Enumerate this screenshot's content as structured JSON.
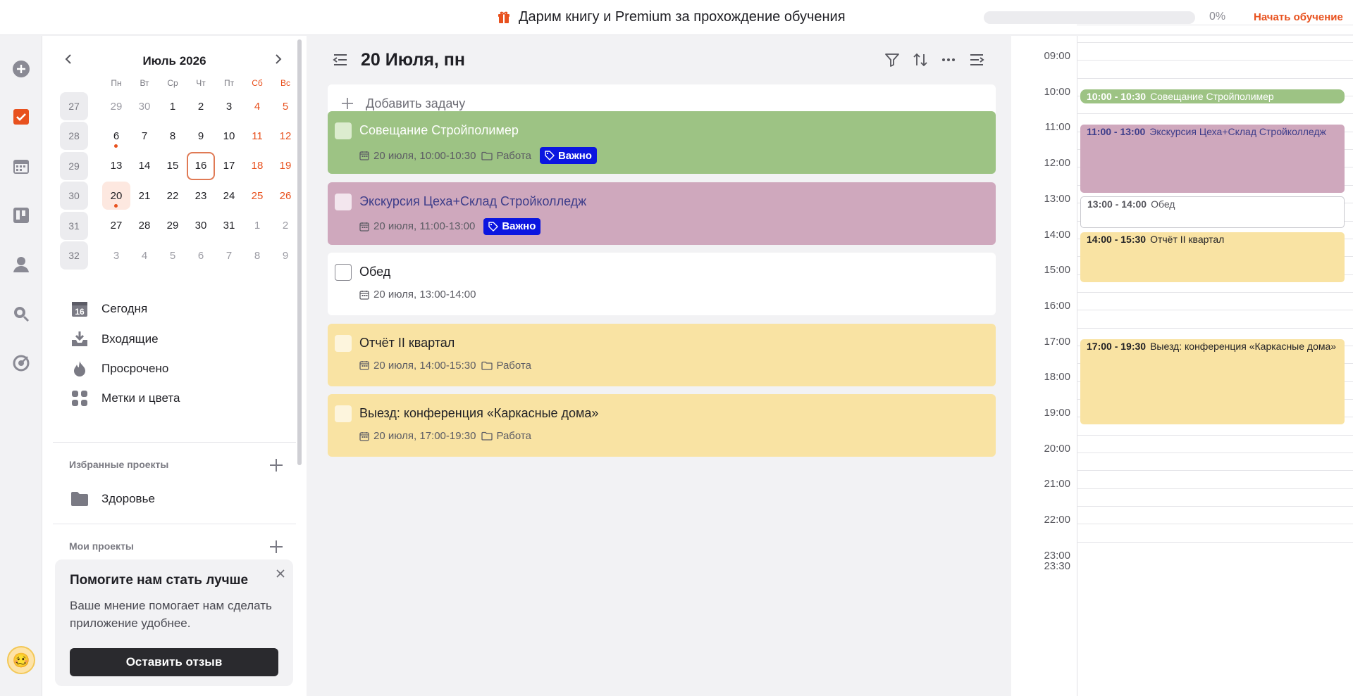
{
  "banner": {
    "promo_icon": "gift-icon",
    "promo_text": "Дарим книгу и Premium за прохождение обучения",
    "progress_percent": 0,
    "progress_label": "0%",
    "start_label": "Начать обучение",
    "accent": "#e8511e"
  },
  "rail": {
    "icons": [
      "add-circle-icon",
      "checkbox-icon",
      "calendar-icon",
      "board-icon",
      "user-icon",
      "search-icon",
      "target-icon"
    ],
    "avatar_emoji": "🥴"
  },
  "calendar": {
    "month_label": "Июль 2026",
    "weekdays": [
      "Пн",
      "Вт",
      "Ср",
      "Чт",
      "Пт",
      "Сб",
      "Вс"
    ],
    "weeks": [
      {
        "num": "27",
        "days": [
          "29",
          "30",
          "1",
          "2",
          "3",
          "4",
          "5"
        ]
      },
      {
        "num": "28",
        "days": [
          "6",
          "7",
          "8",
          "9",
          "10",
          "11",
          "12"
        ]
      },
      {
        "num": "29",
        "days": [
          "13",
          "14",
          "15",
          "16",
          "17",
          "18",
          "19"
        ]
      },
      {
        "num": "30",
        "days": [
          "20",
          "21",
          "22",
          "23",
          "24",
          "25",
          "26"
        ]
      },
      {
        "num": "31",
        "days": [
          "27",
          "28",
          "29",
          "30",
          "31",
          "1",
          "2"
        ]
      },
      {
        "num": "32",
        "days": [
          "3",
          "4",
          "5",
          "6",
          "7",
          "8",
          "9"
        ]
      }
    ],
    "today": "16",
    "selected": "20"
  },
  "nav": {
    "items": [
      {
        "label": "Сегодня",
        "icon": "calendar-16-icon"
      },
      {
        "label": "Входящие",
        "icon": "inbox-icon"
      },
      {
        "label": "Просрочено",
        "icon": "flame-icon"
      },
      {
        "label": "Метки и цвета",
        "icon": "grid-icon"
      }
    ]
  },
  "favorites": {
    "title": "Избранные проекты",
    "projects": [
      {
        "label": "Здоровье",
        "icon": "folder-icon"
      }
    ]
  },
  "my_projects": {
    "title": "Мои проекты"
  },
  "feedback": {
    "title": "Помогите нам стать лучше",
    "text": "Ваше мнение помогает нам сделать приложение удобнее.",
    "button": "Оставить отзыв"
  },
  "main": {
    "title": "20 Июля, пн",
    "add_task_placeholder": "Добавить задачу",
    "tasks": [
      {
        "title": "Совещание Стройполимер",
        "date": "20 июля, 10:00-10:30",
        "project": "Работа",
        "tag": "Важно",
        "bg": "#9dc384",
        "title_color": "#ffffff",
        "cb_color": "#dceccf"
      },
      {
        "title": "Экскурсия Цеха+Склад Стройколледж",
        "date": "20 июля, 11:00-13:00",
        "project": "",
        "tag": "Важно",
        "bg": "#cfa8bd",
        "title_color": "#3d3d8a",
        "cb_color": "#f3e6ee"
      },
      {
        "title": "Обед",
        "date": "20 июля, 13:00-14:00",
        "project": "",
        "tag": "",
        "bg": "#ffffff",
        "title_color": "#1f1f24",
        "cb_color": "#ffffff"
      },
      {
        "title": "Отчёт II квартал",
        "date": "20 июля, 14:00-15:30",
        "project": "Работа",
        "tag": "",
        "bg": "#f9e3a3",
        "title_color": "#1f1f24",
        "cb_color": "#fdf5dd"
      },
      {
        "title": "Выезд: конференция «Каркасные дома»",
        "date": "20 июля, 17:00-19:30",
        "project": "Работа",
        "tag": "",
        "bg": "#f9e3a3",
        "title_color": "#1f1f24",
        "cb_color": "#fdf5dd"
      }
    ]
  },
  "timeline": {
    "hours": [
      "09:00",
      "10:00",
      "11:00",
      "12:00",
      "13:00",
      "14:00",
      "15:00",
      "16:00",
      "17:00",
      "18:00",
      "19:00",
      "20:00",
      "21:00",
      "22:00",
      "23:00",
      "23:30"
    ],
    "events": [
      {
        "time": "10:00 - 10:30",
        "title": "Совещание Стройполимер",
        "start": 10.0,
        "end": 10.5,
        "bg": "#9dc384",
        "color": "#ffffff",
        "border": ""
      },
      {
        "time": "11:00 - 13:00",
        "title": "Экскурсия Цеха+Склад Стройколледж",
        "start": 11.0,
        "end": 13.0,
        "bg": "#cfa8bd",
        "color": "#3d3d8a",
        "border": ""
      },
      {
        "time": "13:00 - 14:00",
        "title": "Обед",
        "start": 13.0,
        "end": 14.0,
        "bg": "#ffffff",
        "color": "#55555c",
        "border": "#c8c8ce"
      },
      {
        "time": "14:00 - 15:30",
        "title": "Отчёт II квартал",
        "start": 14.0,
        "end": 15.5,
        "bg": "#f9e3a3",
        "color": "#1f1f24",
        "border": ""
      },
      {
        "time": "17:00 - 19:30",
        "title": "Выезд: конференция «Каркасные дома»",
        "start": 17.0,
        "end": 19.5,
        "bg": "#f9e3a3",
        "color": "#1f1f24",
        "border": ""
      }
    ]
  }
}
